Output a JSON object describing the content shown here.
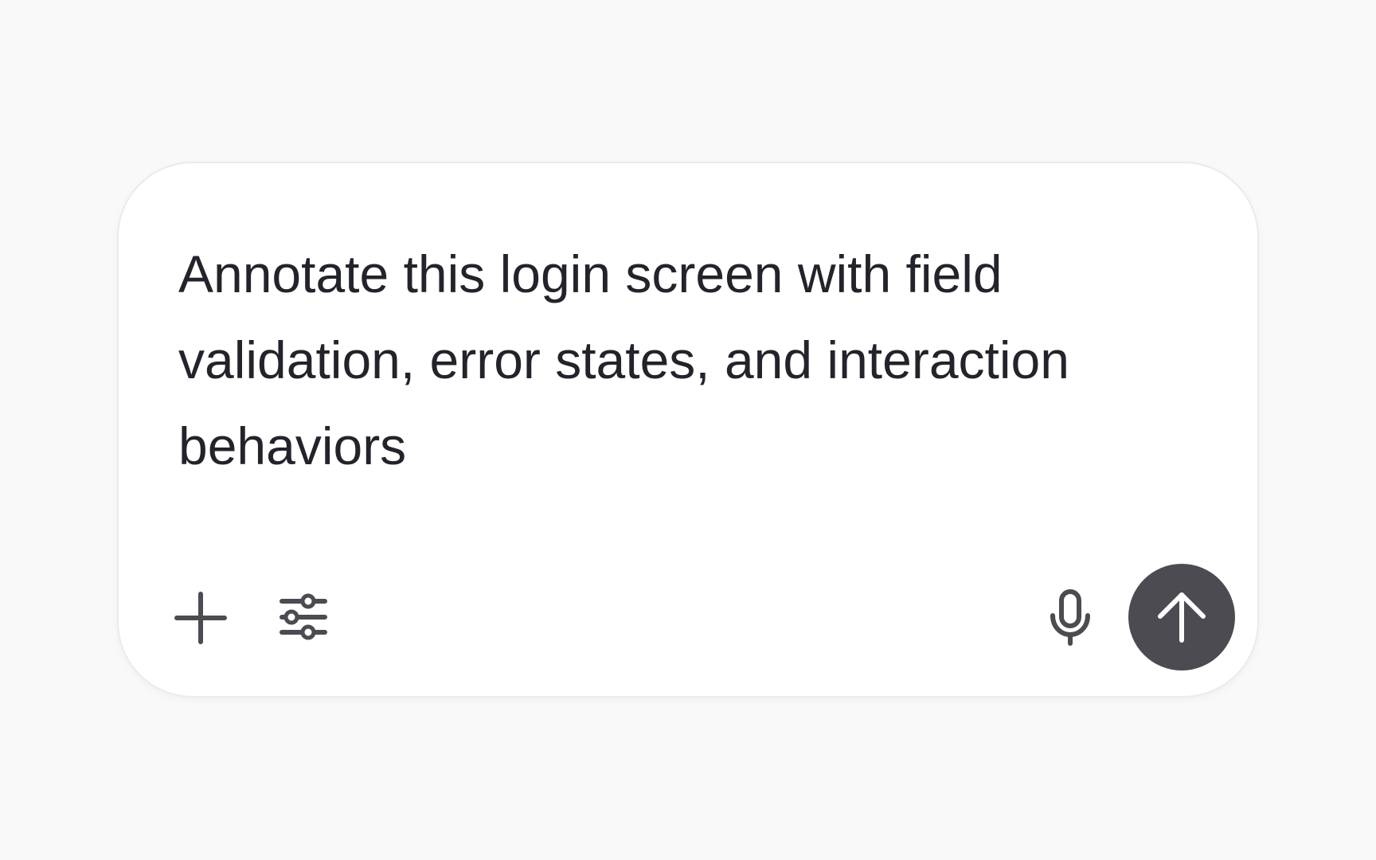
{
  "composer": {
    "prompt_text": "Annotate this login screen with field validation, error states, and interaction behaviors"
  },
  "toolbar": {
    "left_icons": [
      "plus-icon",
      "sliders-icon"
    ],
    "right_icons": [
      "microphone-icon",
      "arrow-up-icon"
    ]
  },
  "colors": {
    "page_background": "#f9f9f9",
    "composer_background": "#ffffff",
    "composer_border": "#ebebeb",
    "text": "#23232b",
    "icon": "#4b4b51",
    "send_button": "#4b4b51",
    "send_icon": "#ffffff"
  }
}
